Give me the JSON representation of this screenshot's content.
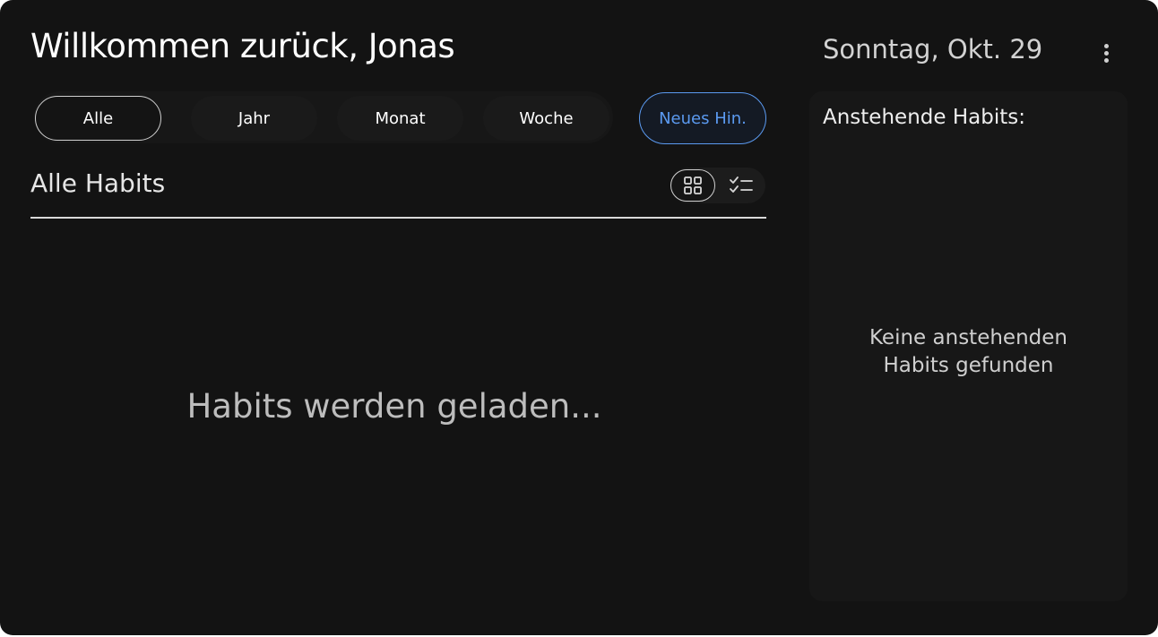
{
  "header": {
    "title": "Willkommen zurück, Jonas",
    "date": "Sonntag, Okt. 29",
    "menu_icon": "more-vertical-icon"
  },
  "filters": {
    "items": [
      {
        "label": "Alle",
        "active": true
      },
      {
        "label": "Jahr",
        "active": false
      },
      {
        "label": "Monat",
        "active": false
      },
      {
        "label": "Woche",
        "active": false
      }
    ],
    "new_button": "Neues Hin."
  },
  "habits": {
    "title": "Alle Habits",
    "view_icons": [
      "grid-view-icon",
      "checklist-view-icon"
    ],
    "active_view": "grid",
    "loading_text": "Habits werden geladen..."
  },
  "upcoming": {
    "title": "Anstehende Habits:",
    "empty_text": "Keine anstehenden Habits gefunden"
  },
  "colors": {
    "background": "#131313",
    "panel": "#171717",
    "accent": "#5b9af0"
  }
}
